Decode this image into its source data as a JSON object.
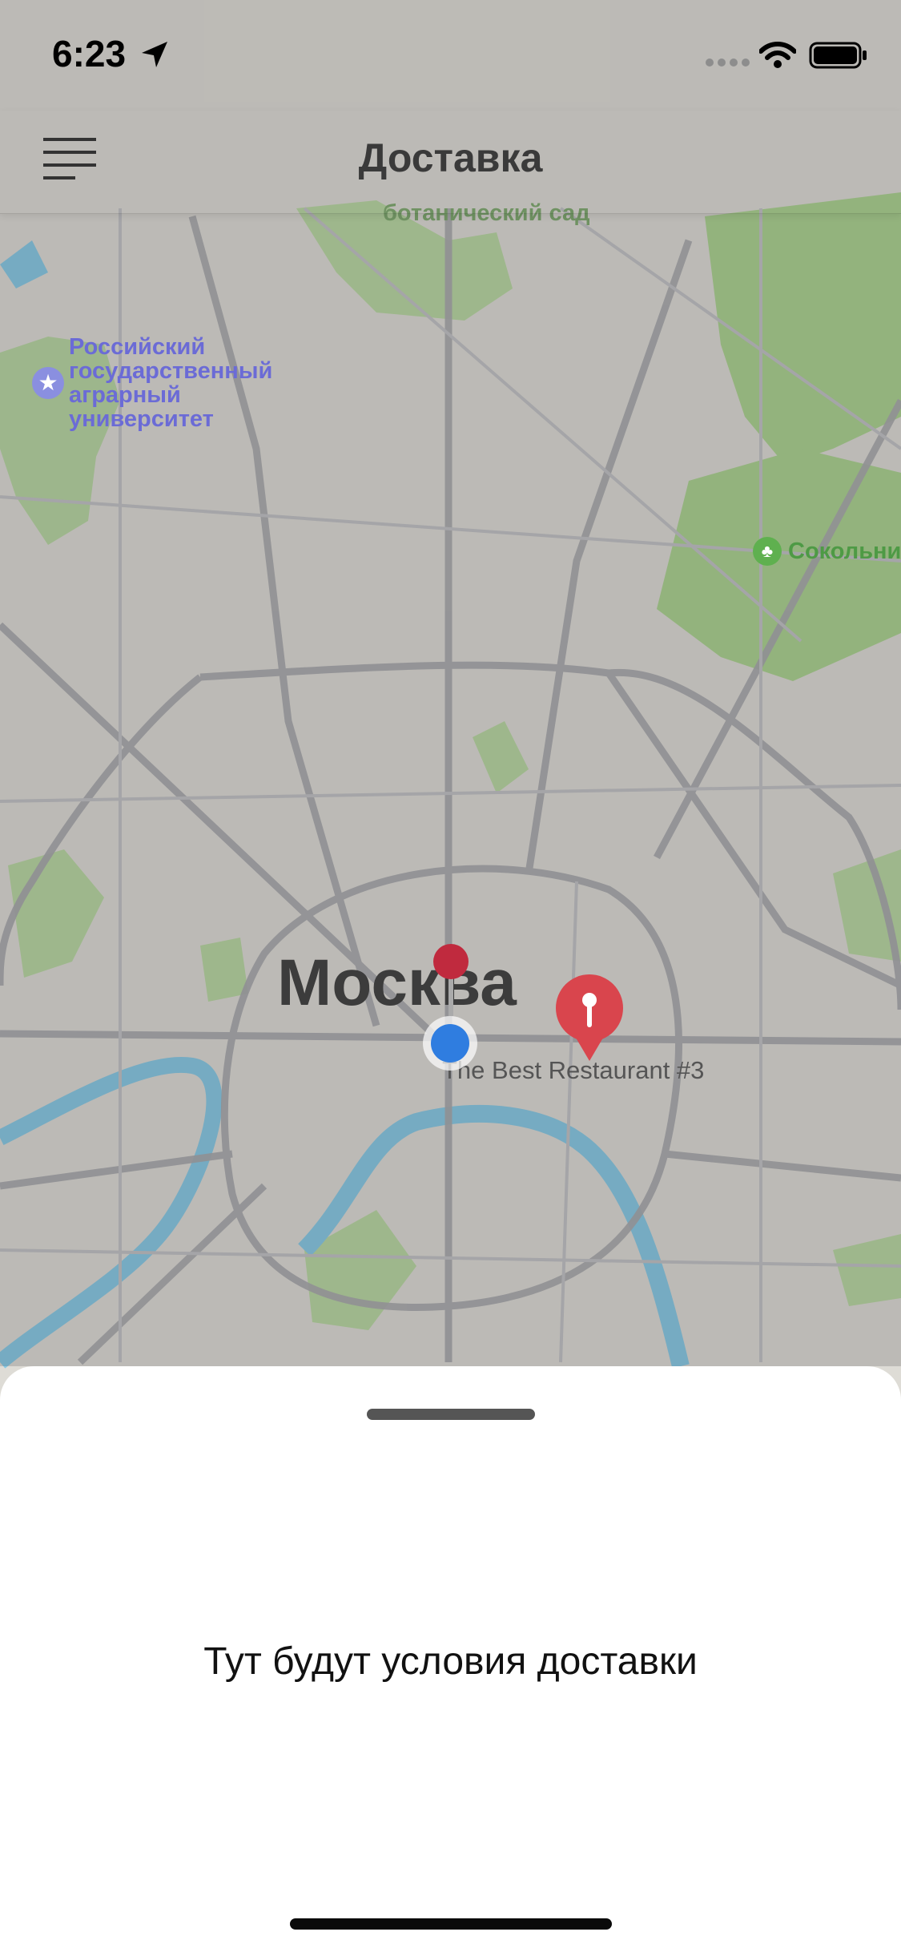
{
  "status_bar": {
    "time": "6:23"
  },
  "nav": {
    "title": "Доставка"
  },
  "map": {
    "city_label": "Москва",
    "labels": [
      {
        "id": "botanical",
        "text": "ботанический сад"
      },
      {
        "id": "university",
        "text": "Российский\nгосударственный\nаграрный\nуниверситет"
      },
      {
        "id": "sokolniki",
        "text": "Сокольни"
      },
      {
        "id": "restaurant",
        "text": "The Best Restaurant #3"
      }
    ]
  },
  "sheet": {
    "text": "Тут будут условия доставки"
  },
  "colors": {
    "accent_red": "#d9454d",
    "user_blue": "#2f7de0",
    "park_green": "#a7d28b",
    "water_blue": "#7cc6e6"
  }
}
